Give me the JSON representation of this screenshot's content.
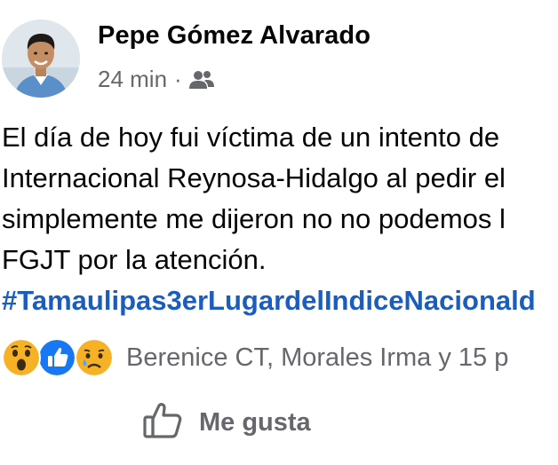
{
  "post": {
    "author": "Pepe Gómez Alvarado",
    "time": "24 min",
    "separator": "·",
    "audience_icon": "friends-icon",
    "text_lines": [
      "El día de hoy fui víctima de un intento de",
      "Internacional Reynosa-Hidalgo al pedir el",
      "simplemente me dijeron no no podemos l",
      "FGJT por la atención."
    ],
    "hashtag": "#Tamaulipas3erLugardelIndiceNacionald"
  },
  "reactions": {
    "icons": [
      "wow-reaction-icon",
      "like-reaction-icon",
      "sad-reaction-icon"
    ],
    "summary": "Berenice CT, Morales Irma y 15 p"
  },
  "actions": {
    "like_label": "Me gusta",
    "like_icon": "thumbs-up-outline-icon"
  },
  "colors": {
    "hashtag": "#1b5dbf",
    "secondary_text": "#65676b",
    "like_reaction": "#1877f2",
    "emoji_yellow": "#f7b125"
  }
}
